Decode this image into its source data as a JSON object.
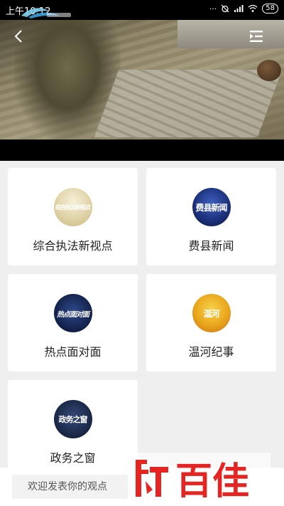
{
  "status_bar": {
    "time": "上午10:12",
    "battery": "58"
  },
  "tiles": [
    {
      "label": "综合执法新视点",
      "thumb_text": "综合执法新视点"
    },
    {
      "label": "费县新闻",
      "thumb_text": "费县新闻"
    },
    {
      "label": "热点面对面",
      "thumb_text": "热点面对面"
    },
    {
      "label": "温河纪事",
      "thumb_text": "温河"
    },
    {
      "label": "政务之窗",
      "thumb_text": "政务之窗"
    }
  ],
  "comment": {
    "placeholder": "欢迎发表你的观点"
  },
  "watermark": {
    "text": "百佳"
  },
  "colors": {
    "background": "#efefef",
    "card": "#ffffff",
    "watermark": "#e52521"
  }
}
